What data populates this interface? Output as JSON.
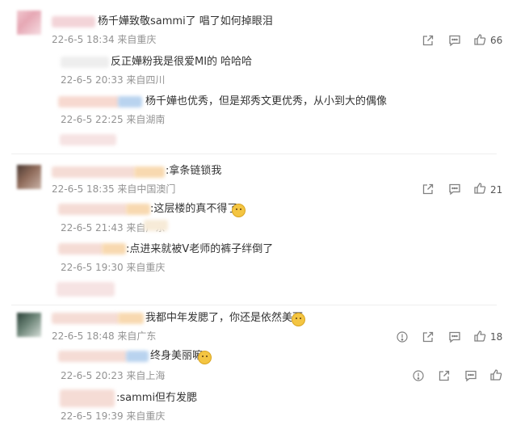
{
  "comments": [
    {
      "text": "杨千嬅致敬sammi了 唱了如何掉眼泪",
      "meta": "22-6-5 18:34 来自重庆",
      "likes": "66",
      "replies": [
        {
          "text": "反正嬅粉我是很爱MI的 哈哈哈",
          "meta": "22-6-5 20:33 来自四川"
        },
        {
          "text": "杨千嬅也优秀，但是郑秀文更优秀，从小到大的偶像",
          "meta": "22-6-5 22:25 来自湖南"
        }
      ]
    },
    {
      "text": ":拿条链锁我",
      "meta": "22-6-5 18:35 来自中国澳门",
      "likes": "21",
      "replies": [
        {
          "text": ":这层楼的真不得了",
          "meta": "22-6-5 21:43 来自广东"
        },
        {
          "text": ":点进来就被V老师的裤子绊倒了",
          "meta": "22-6-5 19:30 来自重庆"
        }
      ]
    },
    {
      "text": "我都中年发腮了，你还是依然美丽",
      "meta": "22-6-5 18:48 来自广东",
      "likes": "18",
      "replies": [
        {
          "text": "终身美丽嘛",
          "meta": "22-6-5 20:23 来自上海"
        },
        {
          "text": ":sammi但冇发腮",
          "meta": "22-6-5 19:39 来自重庆"
        }
      ]
    }
  ],
  "icons": {
    "share": "share-icon",
    "comment": "comment-icon",
    "like": "like-icon",
    "report": "report-icon"
  }
}
